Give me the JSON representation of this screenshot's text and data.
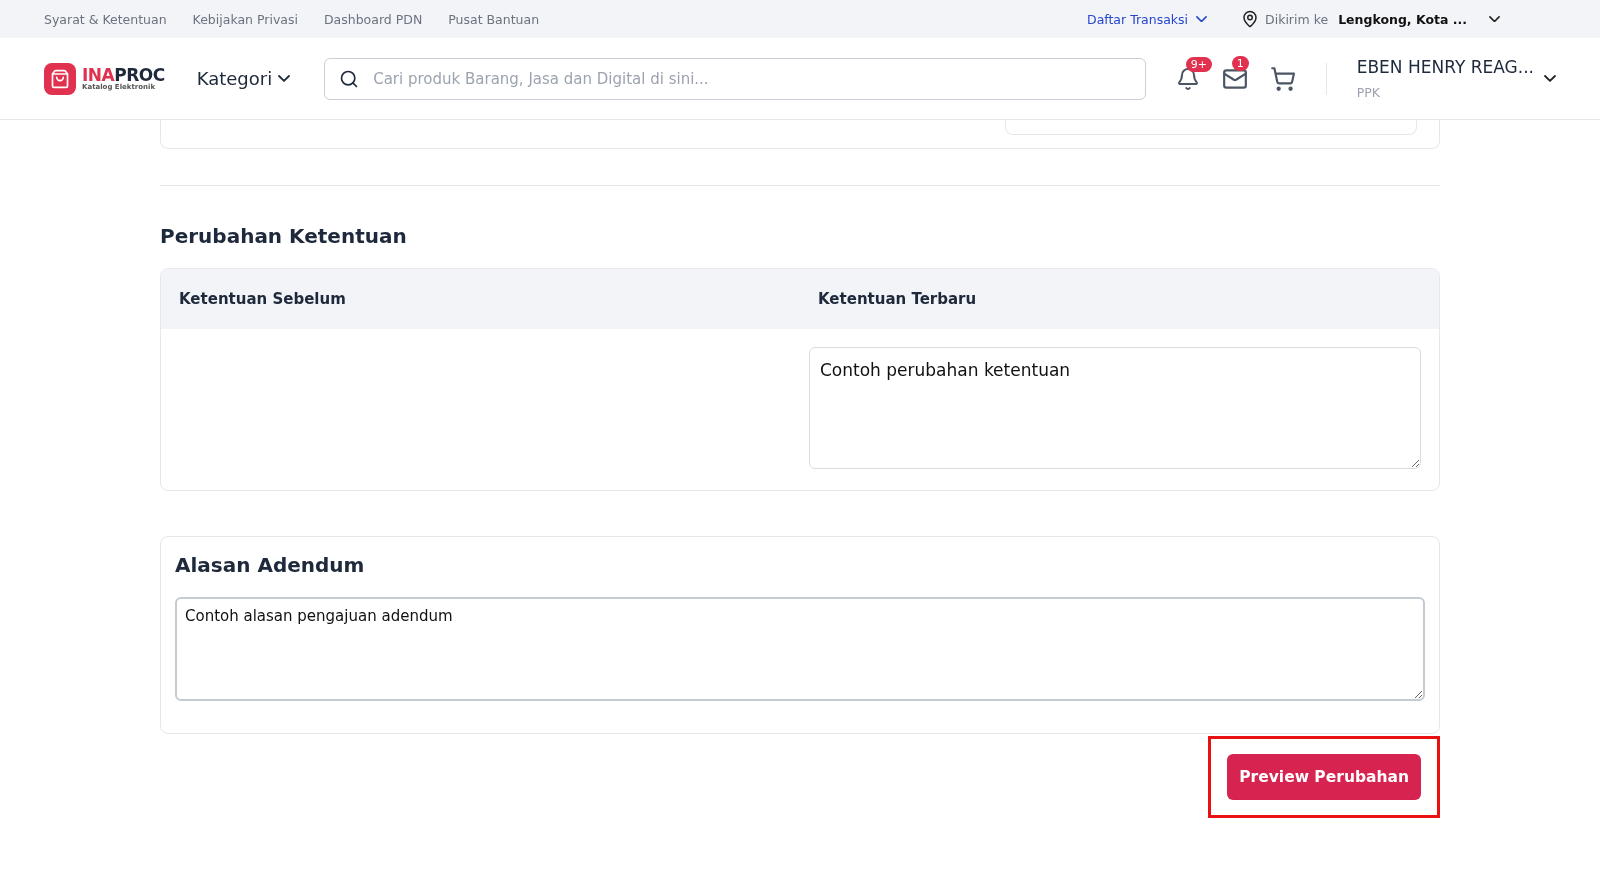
{
  "top_links": [
    "Syarat & Ketentuan",
    "Kebijakan Privasi",
    "Dashboard PDN",
    "Pusat Bantuan"
  ],
  "transactions_link": "Daftar Transaksi",
  "delivery": {
    "label": "Dikirim ke",
    "location": "Lengkong, Kota ..."
  },
  "logo": {
    "brand_a": "INA",
    "brand_b": "PROC",
    "tagline": "Katalog Elektronik"
  },
  "category_button": "Kategori",
  "search": {
    "placeholder": "Cari produk Barang, Jasa dan Digital di sini..."
  },
  "notifications_badge": "9+",
  "messages_badge": "1",
  "user": {
    "name": "EBEN HENRY REAG...",
    "role": "PPK"
  },
  "changes": {
    "title": "Perubahan Ketentuan",
    "columns": [
      "Ketentuan Sebelum",
      "Ketentuan Terbaru"
    ],
    "new_value": "Contoh perubahan ketentuan"
  },
  "reason": {
    "title": "Alasan Adendum",
    "value": "Contoh alasan pengajuan adendum"
  },
  "preview_button": {
    "label": "Preview Perubahan",
    "highlighted": true
  }
}
